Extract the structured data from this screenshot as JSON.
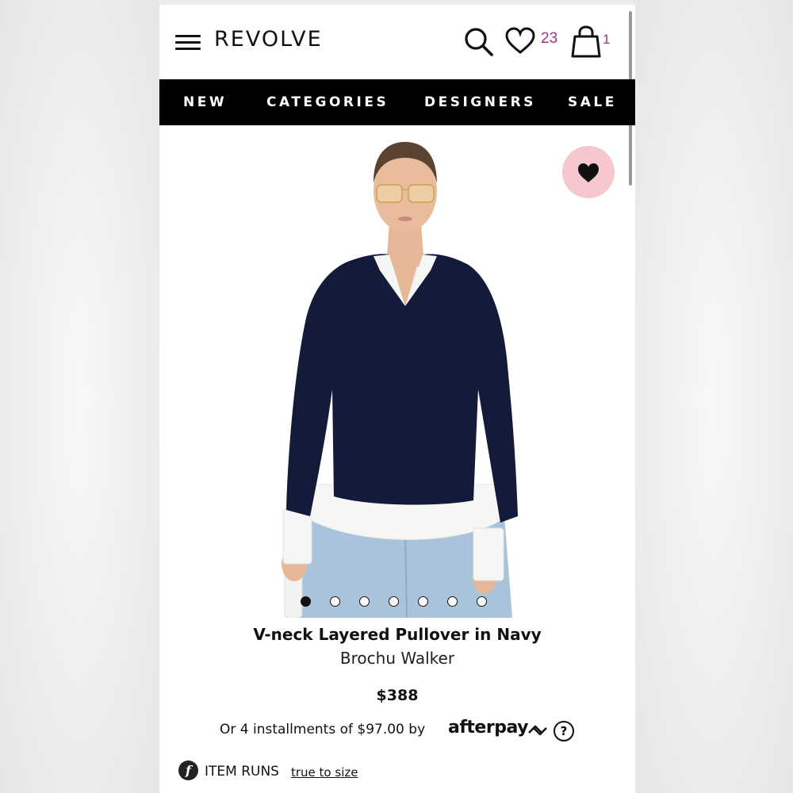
{
  "header": {
    "logo": "REVOLVE",
    "wishlist_count": "23",
    "bag_count": "1",
    "icons": [
      "hamburger-menu-icon",
      "search-icon",
      "heart-icon",
      "shopping-bag-icon"
    ]
  },
  "nav": {
    "items": [
      {
        "label": "NEW"
      },
      {
        "label": "CATEGORIES"
      },
      {
        "label": "DESIGNERS"
      },
      {
        "label": "SALE"
      }
    ]
  },
  "product": {
    "title": "V-neck Layered Pullover in Navy",
    "brand": "Brochu Walker",
    "price": "$388",
    "image_count": 7,
    "active_image_index": 0
  },
  "payment": {
    "installments_text": "Or 4 installments of $97.00 by",
    "provider_logo": "afterpay",
    "help_label": "?"
  },
  "fit": {
    "icon_letter": "f",
    "label": "ITEM RUNS",
    "link": "true to size"
  },
  "colors": {
    "accent_count": "#a2308e",
    "nav_bg": "#000000",
    "fav_bg": "#f6c8cd",
    "sweater": "#141a3a"
  }
}
